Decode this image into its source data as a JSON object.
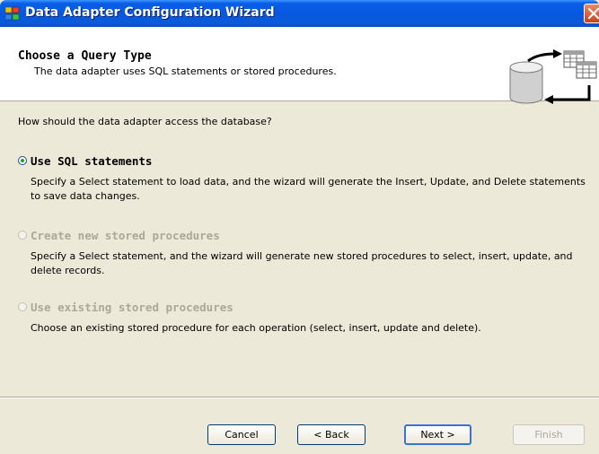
{
  "window": {
    "title": "Data Adapter Configuration Wizard"
  },
  "header": {
    "title": "Choose a Query Type",
    "subtitle": "The data adapter uses SQL statements or stored procedures."
  },
  "main": {
    "question": "How should the data adapter access the database?",
    "options": [
      {
        "label": "Use SQL statements",
        "description": "Specify a Select statement to load data, and the wizard will generate the Insert, Update, and Delete statements to save data changes.",
        "checked": true,
        "enabled": true
      },
      {
        "label": "Create new stored procedures",
        "description": "Specify a Select statement, and the wizard will generate new stored procedures to select, insert, update, and delete records.",
        "checked": false,
        "enabled": false
      },
      {
        "label": "Use existing stored procedures",
        "description": "Choose an existing stored procedure for each operation (select, insert, update and delete).",
        "checked": false,
        "enabled": false
      }
    ]
  },
  "footer": {
    "cancel_label": "Cancel",
    "back_label": "< Back",
    "next_label": "Next >",
    "finish_label": "Finish"
  }
}
